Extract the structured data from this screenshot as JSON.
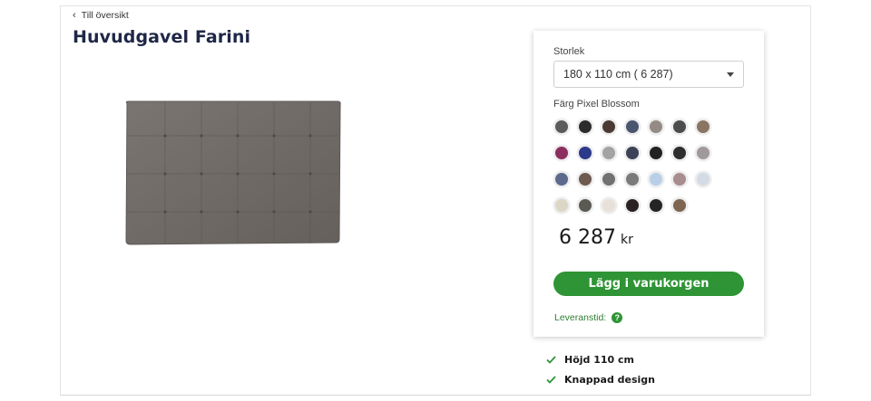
{
  "nav": {
    "back_label": "Till översikt"
  },
  "product": {
    "title": "Huvudgavel Farini",
    "image_color": "#6f6a66"
  },
  "panel": {
    "size_label": "Storlek",
    "size_value": "180 x 110 cm ( 6 287)",
    "color_label": "Färg Pixel Blossom",
    "swatches": [
      "#5b5b5b",
      "#2c2c2c",
      "#4b3a33",
      "#4a5570",
      "#948b86",
      "#4c4c4c",
      "#8a7563",
      "#8c2e5e",
      "#2b3a8a",
      "#a3a3a3",
      "#3c4257",
      "#232323",
      "#2e2e2e",
      "#a0999c",
      "#5d6a8c",
      "#6e5a4f",
      "#717171",
      "#7a7a7a",
      "#b9cfe8",
      "#a88d8e",
      "#d3dce4",
      "#dcd6c4",
      "#5a5a52",
      "#e8e1d9",
      "#2a2222",
      "#242424",
      "#7d6550"
    ],
    "price": "6 287",
    "currency": "kr",
    "cart_label": "Lägg i varukorgen",
    "delivery_label": "Leveranstid:"
  },
  "features": [
    {
      "label": "Höjd 110 cm"
    },
    {
      "label": "Knappad design"
    }
  ],
  "colors": {
    "accent_green": "#2e9435",
    "title_navy": "#1f2747"
  }
}
